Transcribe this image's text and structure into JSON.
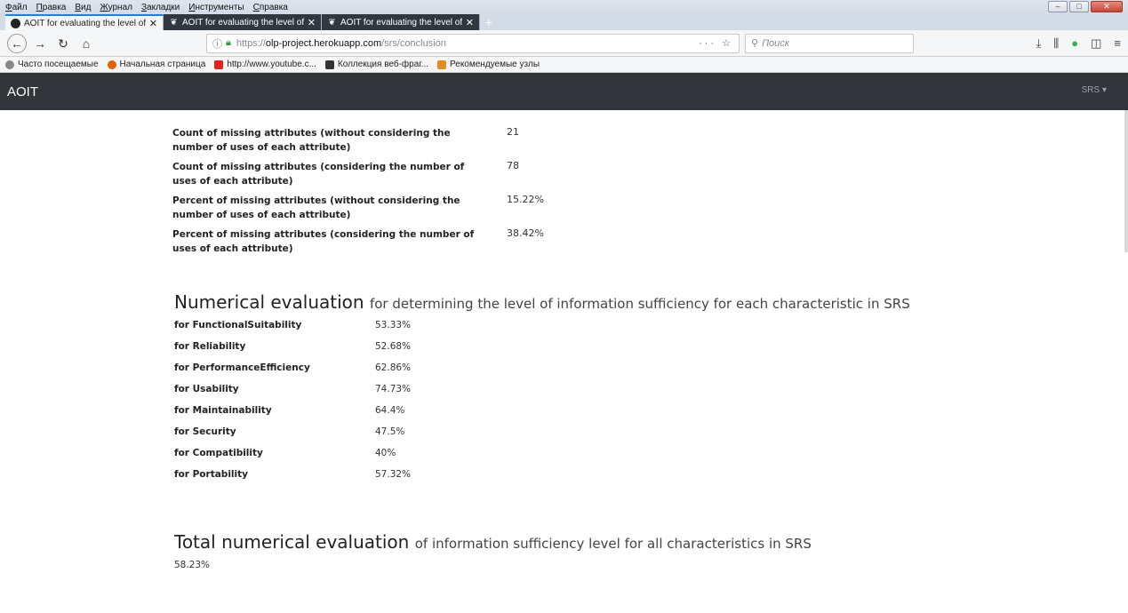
{
  "browser": {
    "menu": [
      "Файл",
      "Правка",
      "Вид",
      "Журнал",
      "Закладки",
      "Инструменты",
      "Справка"
    ],
    "tabs": [
      {
        "title": "AOIT for evaluating the level of"
      },
      {
        "title": "AOIT for evaluating the level of"
      },
      {
        "title": "AOIT for evaluating the level of"
      }
    ],
    "url_prefix": "https://",
    "url_host": "olp-project.herokuapp.com",
    "url_path": "/srs/conclusion",
    "search_placeholder": "Поиск",
    "bookmarks": [
      {
        "label": "Часто посещаемые"
      },
      {
        "label": "Начальная страница"
      },
      {
        "label": "http://www.youtube.c..."
      },
      {
        "label": "Коллекция веб-фраг..."
      },
      {
        "label": "Рекомендуемые узлы"
      }
    ]
  },
  "app": {
    "brand": "AOIT",
    "menu": "SRS ▾"
  },
  "missing": [
    {
      "label": "Count of missing attributes (without considering the number of uses of each attribute)",
      "value": "21"
    },
    {
      "label": "Count of missing attributes (considering the number of uses of each attribute)",
      "value": "78"
    },
    {
      "label": "Percent of missing attributes (without considering the number of uses of each attribute)",
      "value": "15.22%"
    },
    {
      "label": "Percent of missing attributes (considering the number of uses of each attribute)",
      "value": "38.42%"
    }
  ],
  "numerical": {
    "heading": "Numerical evaluation",
    "subheading": "for determining the level of information sufficiency for each characteristic in SRS",
    "rows": [
      {
        "label": "for FunctionalSuitability",
        "value": "53.33%"
      },
      {
        "label": "for Reliability",
        "value": "52.68%"
      },
      {
        "label": "for PerformanceEfficiency",
        "value": "62.86%"
      },
      {
        "label": "for Usability",
        "value": "74.73%"
      },
      {
        "label": "for Maintainability",
        "value": "64.4%"
      },
      {
        "label": "for Security",
        "value": "47.5%"
      },
      {
        "label": "for Compatibility",
        "value": "40%"
      },
      {
        "label": "for Portability",
        "value": "57.32%"
      }
    ]
  },
  "total": {
    "heading": "Total numerical evaluation",
    "subheading": "of information sufficiency level for all characteristics in SRS",
    "value": "58.23%"
  }
}
